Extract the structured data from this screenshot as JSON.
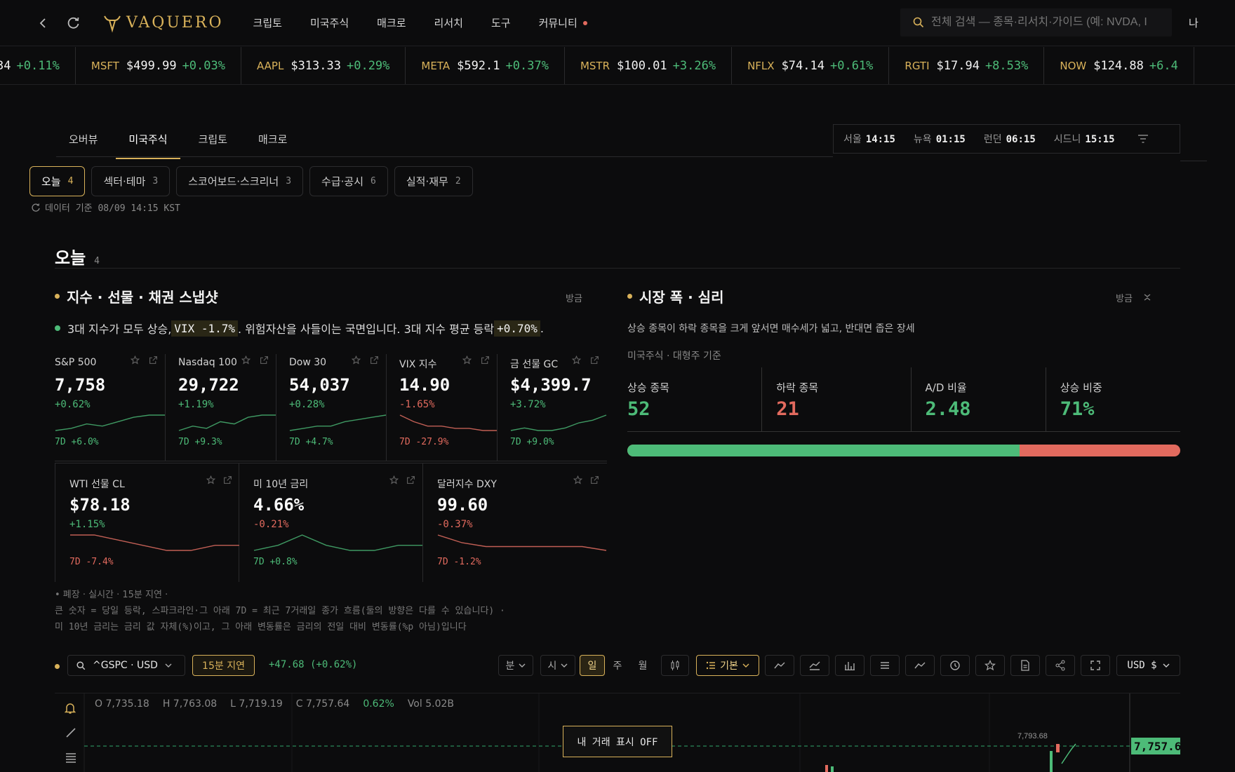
{
  "header": {
    "logo": "VAQUERO",
    "nav": [
      "크립토",
      "미국주식",
      "매크로",
      "리서치",
      "도구",
      "커뮤니티"
    ],
    "search_placeholder": "전체 검색 — 종목·리서치·가이드 (예: NVDA, I",
    "user": "나"
  },
  "ticker": [
    {
      "sym": "",
      "price": "34",
      "chg": "+0.11%",
      "dir": "up"
    },
    {
      "sym": "MSFT",
      "price": "$499.99",
      "chg": "+0.03%",
      "dir": "up"
    },
    {
      "sym": "AAPL",
      "price": "$313.33",
      "chg": "+0.29%",
      "dir": "up"
    },
    {
      "sym": "META",
      "price": "$592.1",
      "chg": "+0.37%",
      "dir": "up"
    },
    {
      "sym": "MSTR",
      "price": "$100.01",
      "chg": "+3.26%",
      "dir": "up"
    },
    {
      "sym": "NFLX",
      "price": "$74.14",
      "chg": "+0.61%",
      "dir": "up"
    },
    {
      "sym": "RGTI",
      "price": "$17.94",
      "chg": "+8.53%",
      "dir": "up"
    },
    {
      "sym": "NOW",
      "price": "$124.88",
      "chg": "+6.4",
      "dir": "up"
    }
  ],
  "tabs": [
    "오버뷰",
    "미국주식",
    "크립토",
    "매크로"
  ],
  "active_tab": 1,
  "clocks": [
    {
      "city": "서울",
      "time": "14:15"
    },
    {
      "city": "뉴욕",
      "time": "01:15"
    },
    {
      "city": "런던",
      "time": "06:15"
    },
    {
      "city": "시드니",
      "time": "15:15"
    }
  ],
  "subtabs": [
    {
      "label": "오늘",
      "count": "4"
    },
    {
      "label": "섹터·테마",
      "count": "3"
    },
    {
      "label": "스코어보드·스크리너",
      "count": "3"
    },
    {
      "label": "수급·공시",
      "count": "6"
    },
    {
      "label": "실적·재무",
      "count": "2"
    }
  ],
  "data_source": "데이터 기준 08/09 14:15 KST",
  "section": {
    "title": "오늘",
    "count": "4"
  },
  "snapshot": {
    "title": "지수 · 선물 · 채권 스냅샷",
    "meta": "방금",
    "summary_pre": "3대 지수가 모두 상승, ",
    "summary_hl1": "VIX -1.7%",
    "summary_mid": ". 위험자산을 사들이는 국면입니다. 3대 지수 평균 등락 ",
    "summary_hl2": "+0.70%",
    "summary_post": ".",
    "cards": [
      {
        "name": "S&P 500",
        "value": "7,758",
        "chg": "+0.62%",
        "dir": "up",
        "wk": "7D +6.0%",
        "wkdir": "up",
        "spark": [
          2,
          3,
          5,
          4,
          6,
          8,
          9,
          9
        ]
      },
      {
        "name": "Nasdaq 100",
        "value": "29,722",
        "chg": "+1.19%",
        "dir": "up",
        "wk": "7D +9.3%",
        "wkdir": "up",
        "spark": [
          2,
          4,
          3,
          6,
          5,
          8,
          9,
          9
        ]
      },
      {
        "name": "Dow 30",
        "value": "54,037",
        "chg": "+0.28%",
        "dir": "up",
        "wk": "7D +4.7%",
        "wkdir": "up",
        "spark": [
          2,
          3,
          4,
          4,
          6,
          7,
          8,
          9
        ]
      },
      {
        "name": "VIX 지수",
        "value": "14.90",
        "chg": "-1.65%",
        "dir": "down",
        "wk": "7D -27.9%",
        "wkdir": "down",
        "spark": [
          9,
          6,
          4,
          4,
          3,
          3,
          2,
          2
        ]
      },
      {
        "name": "금 선물 GC",
        "value": "$4,399.7",
        "chg": "+3.72%",
        "dir": "up",
        "wk": "7D +9.0%",
        "wkdir": "up",
        "spark": [
          3,
          4,
          3,
          3,
          4,
          6,
          7,
          9
        ]
      },
      {
        "name": "WTI 선물 CL",
        "value": "$78.18",
        "chg": "+1.15%",
        "dir": "up",
        "wk": "7D -7.4%",
        "wkdir": "down",
        "spark": [
          8,
          8,
          7,
          6,
          5,
          5,
          6,
          6
        ]
      },
      {
        "name": "미 10년 금리",
        "value": "4.66%",
        "chg": "-0.21%",
        "dir": "down",
        "wk": "7D +0.8%",
        "wkdir": "up",
        "spark": [
          3,
          4,
          6,
          4,
          3,
          3,
          4,
          4
        ]
      },
      {
        "name": "달러지수 DXY",
        "value": "99.60",
        "chg": "-0.37%",
        "dir": "down",
        "wk": "7D -1.2%",
        "wkdir": "down",
        "spark": [
          8,
          6,
          5,
          5,
          5,
          5,
          5,
          4
        ]
      }
    ],
    "notes": [
      "• 폐장 · 실시간 · 15분 지연 ·",
      "큰 숫자 = 당일 등락, 스파크라인·그 아래 7D = 최근 7거래일 종가 흐름(둘의 방향은 다를 수 있습니다) ·",
      "미 10년 금리는 금리 값 자체(%)이고, 그 아래 변동률은 금리의 전일 대비 변동률(%p 아님)입니다"
    ]
  },
  "breadth": {
    "title": "시장 폭 · 심리",
    "meta": "방금",
    "desc": "상승 종목이 하락 종목을 크게 앞서면 매수세가 넓고, 반대면 좁은 장세",
    "scope": "미국주식 · 대형주 기준",
    "stats": [
      {
        "label": "상승 종목",
        "value": "52",
        "dir": "up"
      },
      {
        "label": "하락 종목",
        "value": "21",
        "dir": "down"
      },
      {
        "label": "A/D 비율",
        "value": "2.48",
        "dir": "up"
      },
      {
        "label": "상승 비중",
        "value": "71%",
        "dir": "up"
      }
    ],
    "advance_ratio": 0.71
  },
  "chart": {
    "symbol": "^GSPC · USD",
    "delay": "15분 지연",
    "change": "+47.68 (+0.62%)",
    "intervals": [
      "분",
      "시",
      "일",
      "주",
      "월"
    ],
    "active_interval": "일",
    "style": "기본",
    "currency": "USD $",
    "ohlc": {
      "o": "O 7,735.18",
      "h": "H 7,763.08",
      "l": "L 7,719.19",
      "c": "C 7,757.64",
      "pct": "0.62%",
      "vol": "Vol 5.02B"
    },
    "mytrade": "내 거래 표시 OFF",
    "high_label": "7,793.68",
    "last_price": "7,757.6"
  },
  "colors": {
    "accent": "#d9b25a",
    "up": "#4dbb78",
    "down": "#e26a5e",
    "bg": "#0c0c0d"
  }
}
